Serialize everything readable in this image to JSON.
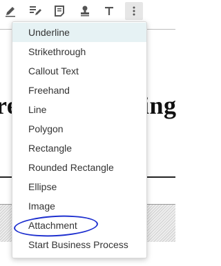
{
  "toolbar": {
    "tools": [
      {
        "name": "highlight-pen-icon",
        "glyph": "✎"
      },
      {
        "name": "ink-annotation-icon",
        "glyph": "✍"
      },
      {
        "name": "note-icon",
        "glyph": "🗒"
      },
      {
        "name": "stamp-icon",
        "glyph": "♟"
      },
      {
        "name": "text-icon",
        "glyph": "T"
      },
      {
        "name": "more-options-icon",
        "glyph": "⋮"
      }
    ]
  },
  "document": {
    "heading_left": "re",
    "heading_right": "ing"
  },
  "menu": {
    "items": [
      "Underline",
      "Strikethrough",
      "Callout Text",
      "Freehand",
      "Line",
      "Polygon",
      "Rectangle",
      "Rounded Rectangle",
      "Ellipse",
      "Image",
      "Attachment",
      "Start Business Process"
    ]
  },
  "colors": {
    "highlight_bg": "#e6f2f4",
    "annotation_circle": "#1d2fcf"
  }
}
